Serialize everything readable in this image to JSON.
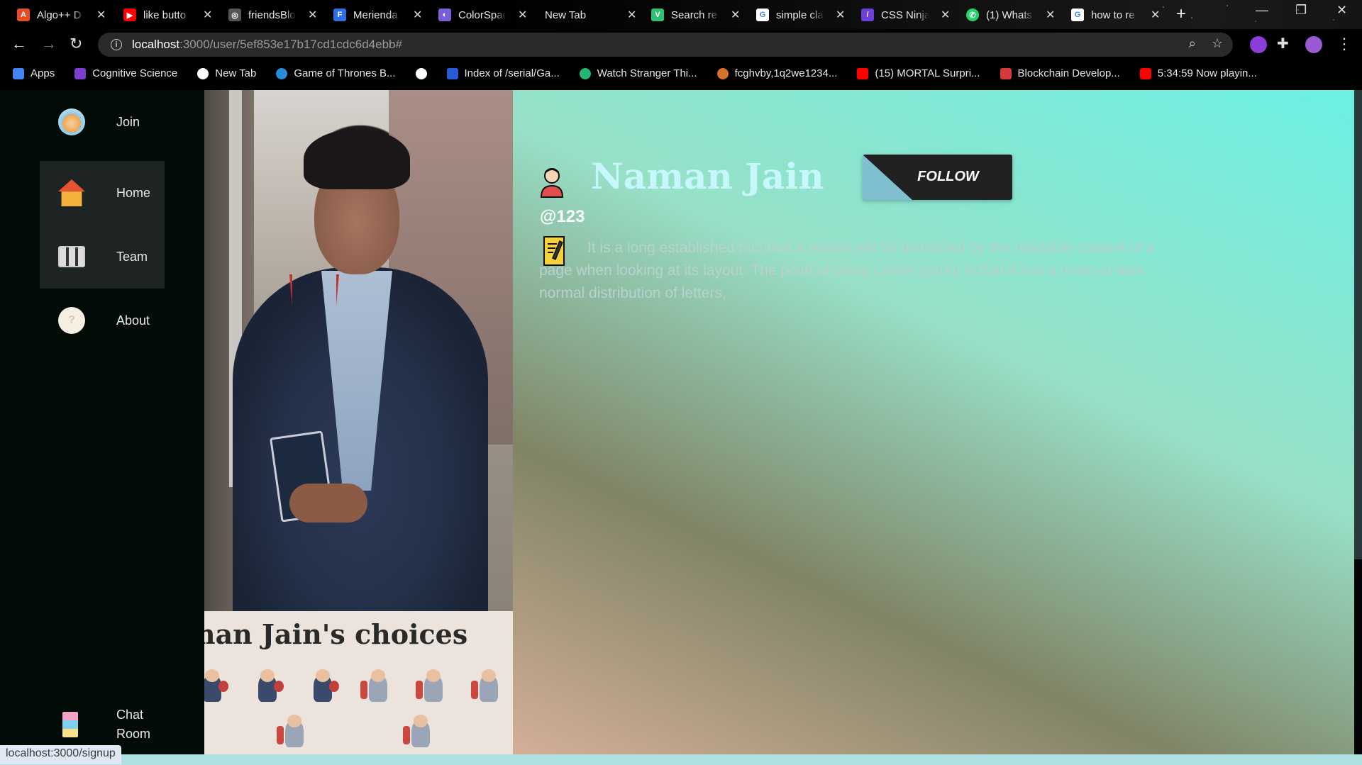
{
  "browser": {
    "tabs": [
      {
        "label": "Algo++ D",
        "color": "#e44d26",
        "glyph": "A"
      },
      {
        "label": "like butto",
        "color": "#ff0000",
        "glyph": "▶"
      },
      {
        "label": "friendsBlo",
        "color": "#555555",
        "glyph": "◎"
      },
      {
        "label": "Merienda",
        "color": "#2f6fe4",
        "glyph": "F"
      },
      {
        "label": "ColorSpac",
        "color": "#7b5fd6",
        "glyph": "◐"
      },
      {
        "label": "New Tab",
        "color": "",
        "glyph": ""
      },
      {
        "label": "Search re",
        "color": "#2fbf71",
        "glyph": "V"
      },
      {
        "label": "simple cla",
        "color": "#ffffff",
        "glyph": "G"
      },
      {
        "label": "CSS Ninja",
        "color": "#6b3fd8",
        "glyph": "/"
      },
      {
        "label": "(1) Whats",
        "color": "#25d366",
        "glyph": "✆"
      },
      {
        "label": "how to re",
        "color": "#ffffff",
        "glyph": "G"
      }
    ],
    "url_host": "localhost",
    "url_path": ":3000/user/5ef853e17b17cd1cdc6d4ebb#",
    "bookmarks": [
      {
        "label": "Apps",
        "color": "#4285f4"
      },
      {
        "label": "Cognitive Science",
        "color": "#7b3fd0"
      },
      {
        "label": "New Tab",
        "color": "#ffffff"
      },
      {
        "label": "Game of Thrones B...",
        "color": "#2a8bd6"
      },
      {
        "label": "",
        "color": "#ffffff"
      },
      {
        "label": "Index of /serial/Ga...",
        "color": "#2a5bd6"
      },
      {
        "label": "Watch Stranger Thi...",
        "color": "#22b573"
      },
      {
        "label": "fcghvby,1q2we1234...",
        "color": "#d4722a"
      },
      {
        "label": "(15) MORTAL Surpri...",
        "color": "#ff0000"
      },
      {
        "label": "Blockchain Develop...",
        "color": "#d63b3b"
      },
      {
        "label": "5:34:59 Now playin...",
        "color": "#ff0000"
      }
    ],
    "status_url": "localhost:3000/signup"
  },
  "sidebar": {
    "items": [
      {
        "label": "Join",
        "icon": "bear-icon"
      },
      {
        "label": "Home",
        "icon": "house-icon"
      },
      {
        "label": "Team",
        "icon": "team-icon"
      },
      {
        "label": "About",
        "icon": "question-icon"
      }
    ],
    "chat_room": {
      "line1": "Chat",
      "line2": "Room",
      "icon": "chat-icon"
    }
  },
  "profile": {
    "name": "Naman Jain",
    "handle": "@123",
    "follow_label": "FOLLOW",
    "bio": "It is a long established fact that a reader will be distracted by the readable content of a page when looking at its layout. The point of using Lorem Ipsum is that it has a more-or-less normal distribution of letters,",
    "choices_title": "Naman Jain's choices"
  },
  "colors": {
    "accent_name": "#c6f7fb",
    "follow_bg": "#212121",
    "follow_tri": "#7fbfcf"
  }
}
